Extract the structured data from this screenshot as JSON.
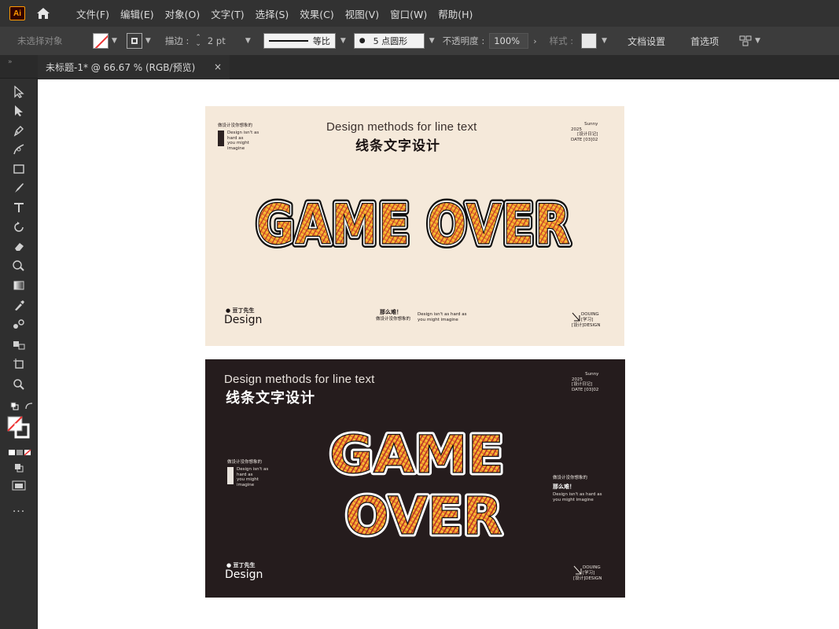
{
  "app": {
    "logo_text": "Ai"
  },
  "menu": {
    "items": [
      "文件(F)",
      "编辑(E)",
      "对象(O)",
      "文字(T)",
      "选择(S)",
      "效果(C)",
      "视图(V)",
      "窗口(W)",
      "帮助(H)"
    ]
  },
  "controlbar": {
    "selection_label": "未选择对象",
    "stroke_label": "描边 :",
    "stroke_value": "2 pt",
    "stroke_profile": "等比",
    "brush_value": "5 点圆形",
    "opacity_label": "不透明度 :",
    "opacity_value": "100%",
    "style_label": "样式 :",
    "doc_setup": "文档设置",
    "preferences": "首选项"
  },
  "tab": {
    "title": "未标题-1* @ 66.67 % (RGB/预览)",
    "close": "×"
  },
  "artboard_light": {
    "title_en": "Design methods for line text",
    "title_cn": "线条文字设计",
    "top_left_cn": "做设计没你想象的",
    "top_left_en1": "Design isn't as",
    "top_left_en2": "hard as",
    "top_left_en3": "you might",
    "top_left_en4": "imagine",
    "top_right_1": "Sunny",
    "top_right_2": "2025",
    "top_right_3": "[设计日记]",
    "top_right_4": "DATE",
    "top_right_5": "[03]02",
    "main_text": "GAME OVER",
    "bottom_left_1": "● 豆丁先生",
    "bottom_left_2": "Design",
    "bottom_mid_cn": "那么难！",
    "bottom_mid_cn2": "做设计没你想象的",
    "bottom_mid_en1": "Design isn't as hard as",
    "bottom_mid_en2": "you might imagine",
    "bottom_right_1": "DOUING",
    "bottom_right_2": "[学习]",
    "bottom_right_3": "[设计]DESIGN"
  },
  "artboard_dark": {
    "title_en": "Design methods for line text",
    "title_cn": "线条文字设计",
    "top_right_1": "Sunny",
    "top_right_2": "2025",
    "top_right_3": "[设计日记]",
    "top_right_4": "DATE",
    "top_right_5": "[03]02",
    "main_line1": "GAME",
    "main_line2": "OVER",
    "left_cn": "做设计没你想象的",
    "left_en1": "Design isn't as",
    "left_en2": "hard as",
    "left_en3": "you might",
    "left_en4": "imagine",
    "right_cn": "做设计没你想象的",
    "right_cn2": "那么难！",
    "right_en1": "Design isn't as hard as",
    "right_en2": "you might imagine",
    "bottom_left_1": "● 豆丁先生",
    "bottom_left_2": "Design",
    "bottom_right_1": "DOUING",
    "bottom_right_2": "[学习]",
    "bottom_right_3": "[设计]DESIGN"
  },
  "colors": {
    "light_bg": "#f5e9da",
    "dark_bg": "#251c1d",
    "type_yellow": "#f7c531",
    "type_orange": "#f08c1e",
    "type_red": "#d9332b",
    "outline": "#111111"
  }
}
